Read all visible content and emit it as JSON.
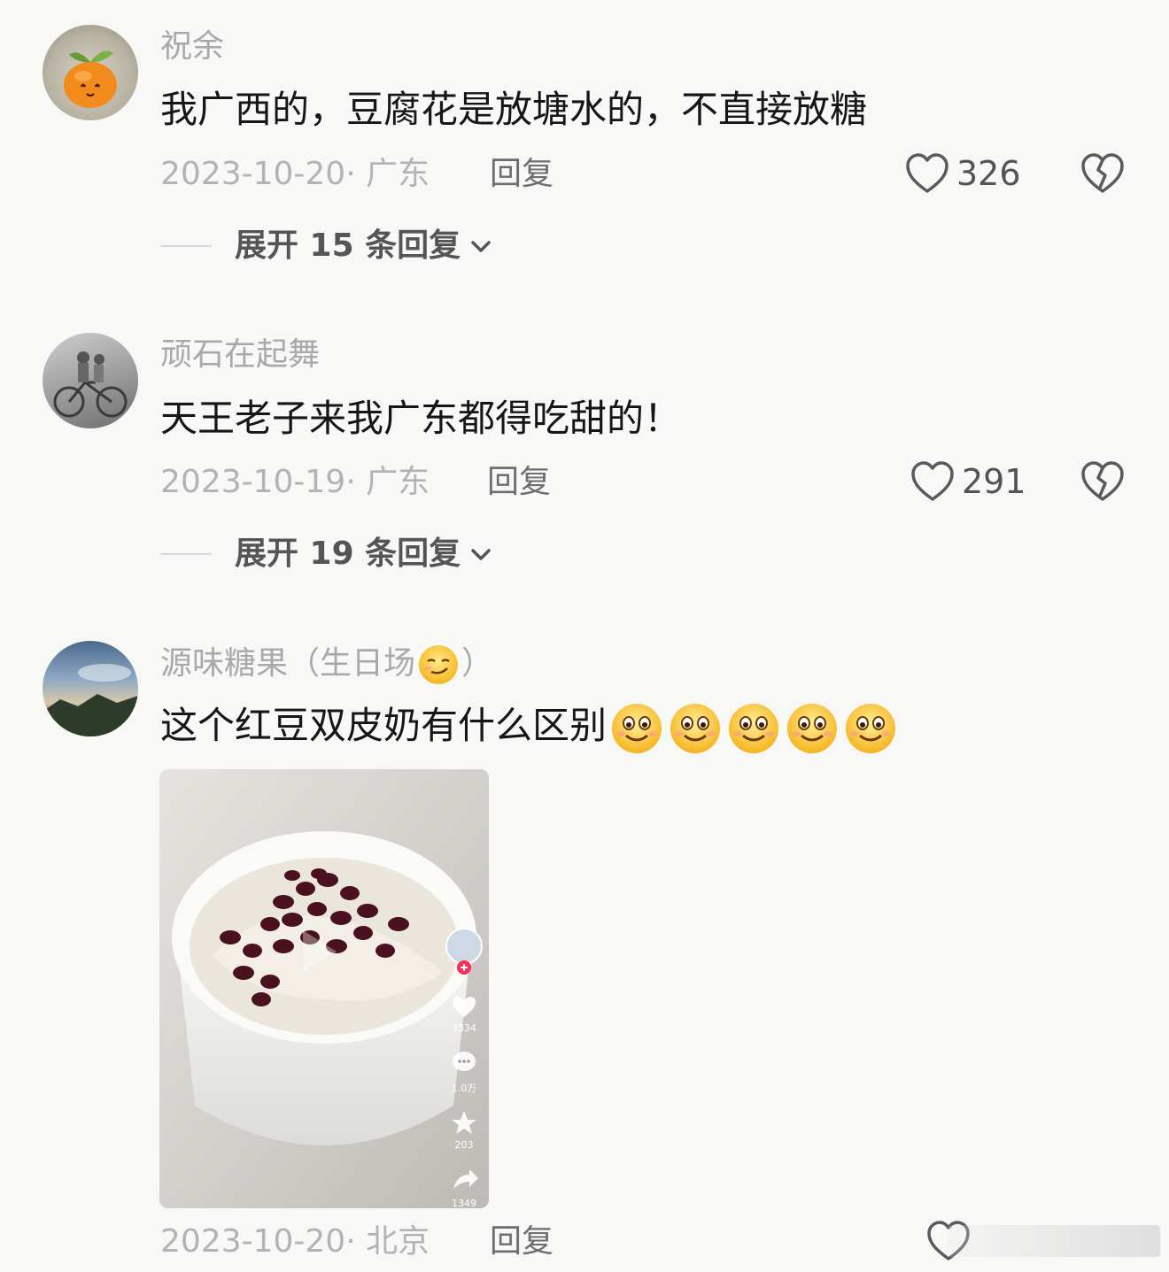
{
  "comments": [
    {
      "username": "祝余",
      "text": "我广西的，豆腐花是放塘水的，不直接放糖",
      "date": "2023-10-20",
      "location": "· 广东",
      "reply_label": "回复",
      "likes": "326",
      "expand_label": "展开 15 条回复"
    },
    {
      "username": "顽石在起舞",
      "text": "天王老子来我广东都得吃甜的！",
      "date": "2023-10-19",
      "location": "· 广东",
      "reply_label": "回复",
      "likes": "291",
      "expand_label": "展开 19 条回复"
    },
    {
      "username_prefix": "源味糖果（生日场",
      "username_suffix": "）",
      "text": "这个红豆双皮奶有什么区别",
      "date": "2023-10-20",
      "location": "· 北京",
      "reply_label": "回复",
      "video": {
        "likes": "3334",
        "comments": "1.0万",
        "favorites": "203",
        "shares": "1349"
      }
    }
  ],
  "icons": {
    "like": "heart-outline-icon",
    "dislike": "broken-heart-icon",
    "expand": "chevron-down-icon",
    "smirk": "smirk-emoji",
    "smile": "smile-emoji"
  },
  "colors": {
    "background": "#f8f8f6",
    "text": "#161616",
    "meta": "#b3b3b3",
    "username": "#a9a9a9"
  }
}
